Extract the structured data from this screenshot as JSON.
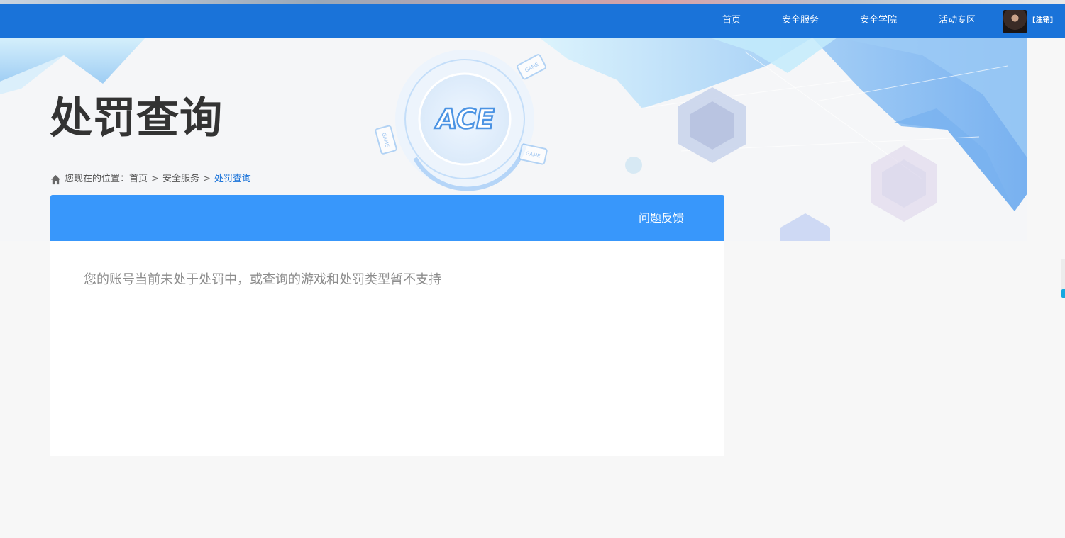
{
  "nav": {
    "items": [
      {
        "label": "首页"
      },
      {
        "label": "安全服务"
      },
      {
        "label": "安全学院"
      },
      {
        "label": "活动专区"
      }
    ],
    "logout_label": "[注销]"
  },
  "banner": {
    "logo_text": "ACE",
    "game_tag": "GAME"
  },
  "page": {
    "title": "处罚查询"
  },
  "breadcrumb": {
    "prefix": "您现在的位置：",
    "items": [
      {
        "label": "首页"
      },
      {
        "label": "安全服务"
      },
      {
        "label": "处罚查询"
      }
    ],
    "separator": ">"
  },
  "panel": {
    "feedback_label": "问题反馈",
    "message": "您的账号当前未处于处罚中，或查询的游戏和处罚类型暂不支持"
  },
  "colors": {
    "nav_bg": "#1a73d9",
    "panel_header": "#3897fb",
    "accent": "#1a73d9"
  }
}
